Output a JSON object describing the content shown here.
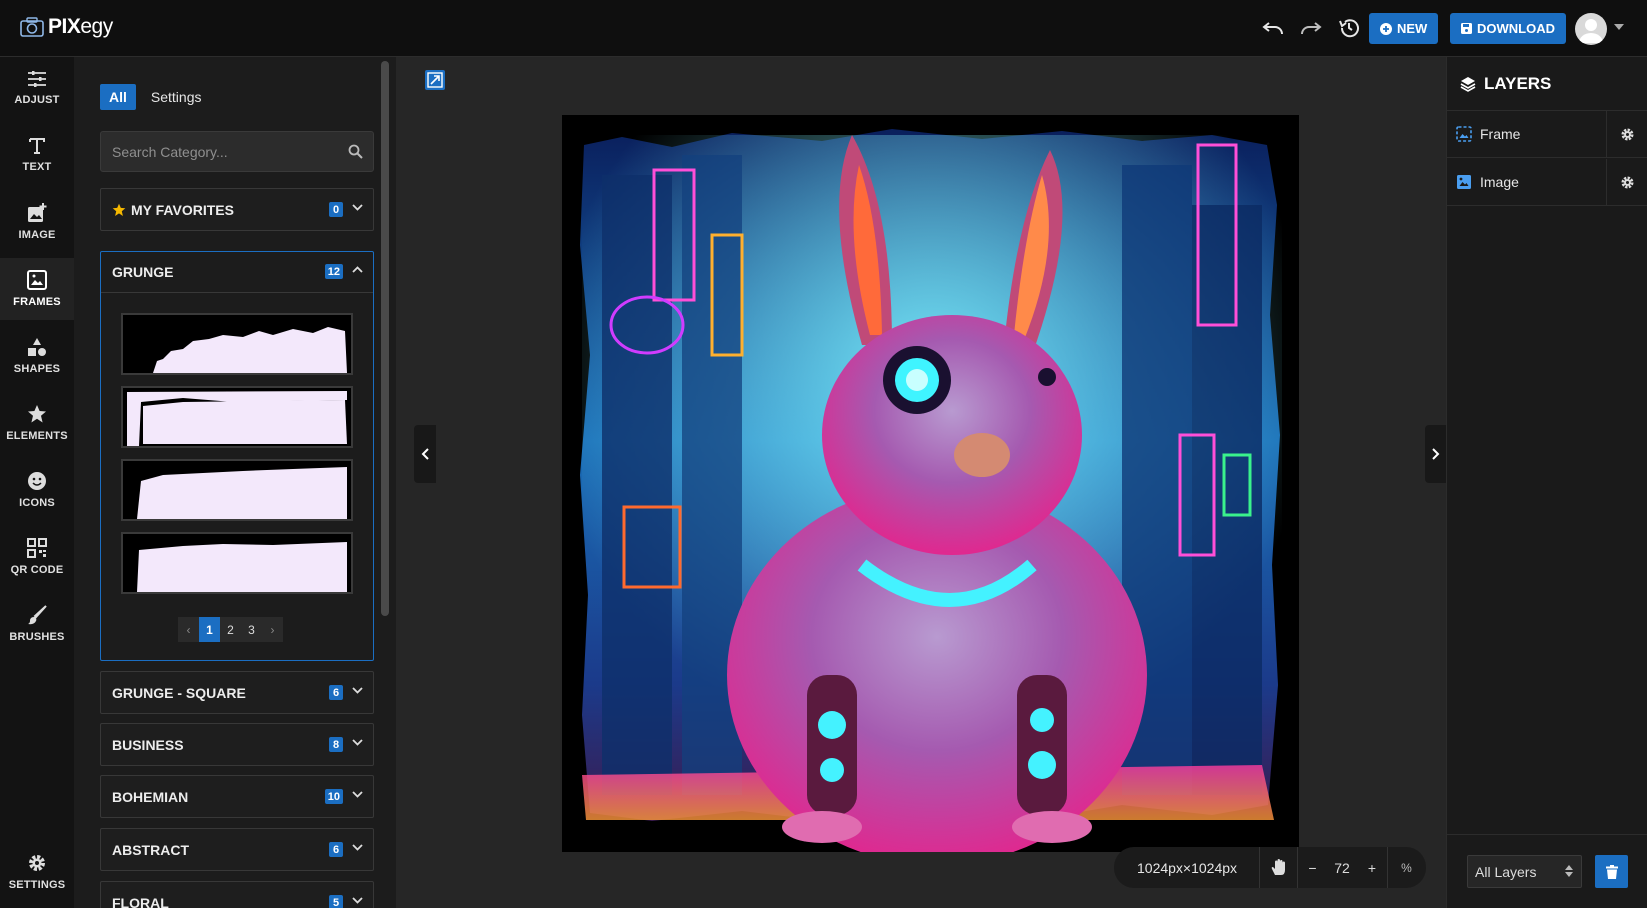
{
  "app": {
    "logo_bold": "PIX",
    "logo_light": "egy"
  },
  "topbar": {
    "new_label": "NEW",
    "download_label": "DOWNLOAD"
  },
  "rail": {
    "items": [
      {
        "label": "ADJUST",
        "icon": "sliders-icon"
      },
      {
        "label": "TEXT",
        "icon": "text-icon"
      },
      {
        "label": "IMAGE",
        "icon": "image-add-icon"
      },
      {
        "label": "FRAMES",
        "icon": "frame-icon"
      },
      {
        "label": "SHAPES",
        "icon": "shapes-icon"
      },
      {
        "label": "ELEMENTS",
        "icon": "star-icon"
      },
      {
        "label": "ICONS",
        "icon": "smiley-icon"
      },
      {
        "label": "QR CODE",
        "icon": "qr-code-icon"
      },
      {
        "label": "BRUSHES",
        "icon": "brush-icon"
      }
    ],
    "settings_label": "SETTINGS",
    "active": "FRAMES"
  },
  "panel": {
    "tabs": [
      "All",
      "Settings"
    ],
    "search_placeholder": "Search Category...",
    "categories": [
      {
        "title": "MY FAVORITES",
        "count": "0"
      },
      {
        "title": "GRUNGE",
        "count": "12"
      },
      {
        "title": "GRUNGE - SQUARE",
        "count": "6"
      },
      {
        "title": "BUSINESS",
        "count": "8"
      },
      {
        "title": "BOHEMIAN",
        "count": "10"
      },
      {
        "title": "ABSTRACT",
        "count": "6"
      },
      {
        "title": "FLORAL",
        "count": "5"
      }
    ],
    "pages": [
      "1",
      "2",
      "3"
    ],
    "prev": "‹",
    "next": "›"
  },
  "zoom": {
    "size": "1024px×1024px",
    "level": "72",
    "minus": "−",
    "plus": "+",
    "percent": "%"
  },
  "layers": {
    "title": "LAYERS",
    "items": [
      "Frame",
      "Image"
    ],
    "filter": "All Layers"
  },
  "colors": {
    "accent": "#1b6ec2",
    "bg_dark": "#0f0f0f",
    "frame_fill": "#f3e8fb"
  }
}
